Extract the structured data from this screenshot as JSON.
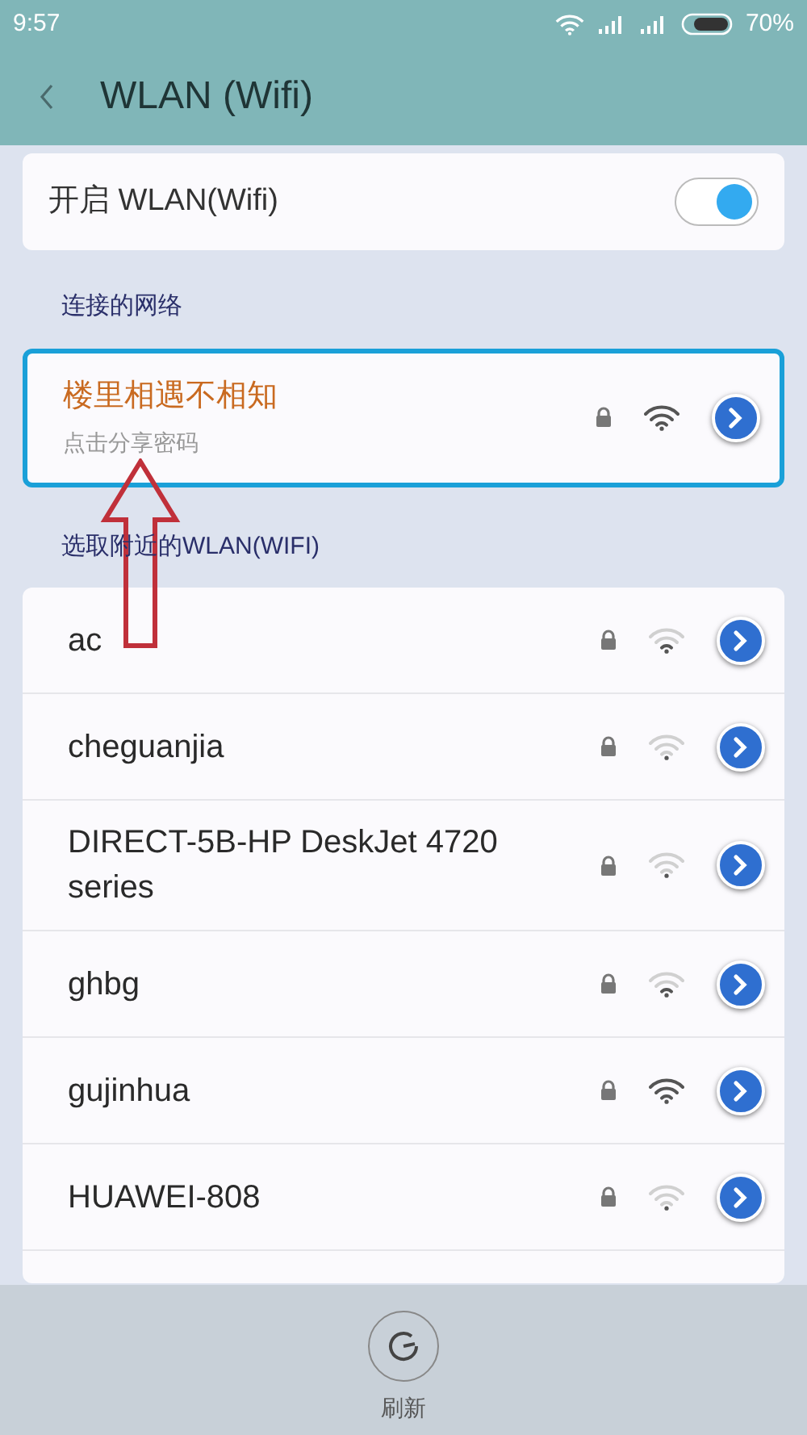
{
  "status_bar": {
    "time": "9:57",
    "battery": "70%"
  },
  "header": {
    "title": "WLAN (Wifi)"
  },
  "wlan_toggle": {
    "label": "开启 WLAN(Wifi)",
    "on": true
  },
  "connected_section": {
    "title": "连接的网络",
    "network": {
      "name": "楼里相遇不相知",
      "subtitle": "点击分享密码",
      "locked": true,
      "kind": "strong",
      "selected": true
    }
  },
  "nearby_section": {
    "title": "选取附近的WLAN(WIFI)",
    "networks": [
      {
        "name": "ac",
        "locked": true,
        "kind": "weak"
      },
      {
        "name": "cheguanjia",
        "locked": true,
        "kind": "faint"
      },
      {
        "name": "DIRECT-5B-HP DeskJet 4720 series",
        "locked": true,
        "kind": "faint"
      },
      {
        "name": "ghbg",
        "locked": true,
        "kind": "weak"
      },
      {
        "name": "gujinhua",
        "locked": true,
        "kind": "strong"
      },
      {
        "name": "HUAWEI-808",
        "locked": true,
        "kind": "faint"
      }
    ]
  },
  "bottom_bar": {
    "refresh_label": "刷新"
  }
}
